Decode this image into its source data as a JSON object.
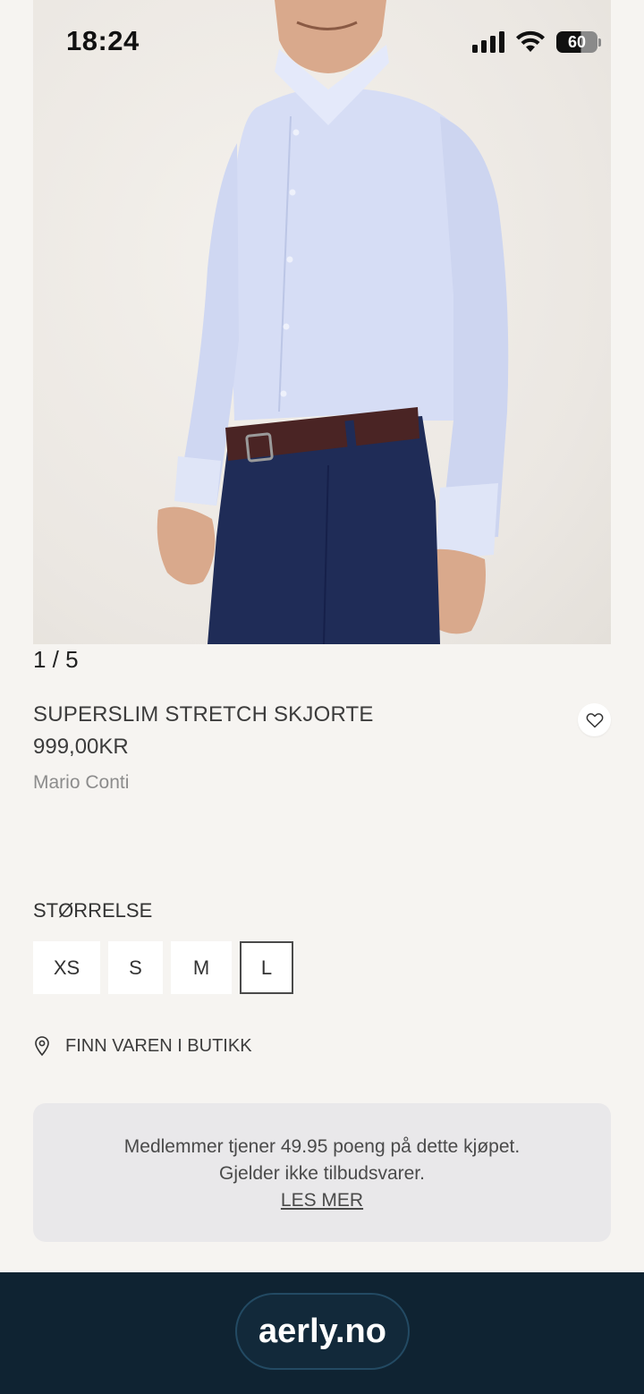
{
  "status_bar": {
    "time": "18:24",
    "battery": "60"
  },
  "gallery": {
    "counter": "1 / 5",
    "current": 1,
    "total": 5
  },
  "product": {
    "title": "SUPERSLIM STRETCH SKJORTE",
    "price": "999,00KR",
    "brand": "Mario Conti"
  },
  "sizes": {
    "heading": "STØRRELSE",
    "options": [
      "XS",
      "S",
      "M",
      "L"
    ],
    "selected": "L"
  },
  "store": {
    "label": "FINN VAREN I BUTIKK"
  },
  "membership": {
    "line1": "Medlemmer tjener 49.95 poeng på dette kjøpet.",
    "line2": "Gjelder ikke tilbudsvarer.",
    "link": "LES MER"
  },
  "footer": {
    "domain": "aerly.no"
  },
  "colors": {
    "background": "#f6f4f1",
    "footer": "#0f2332",
    "member_box": "#e9e8ea"
  }
}
